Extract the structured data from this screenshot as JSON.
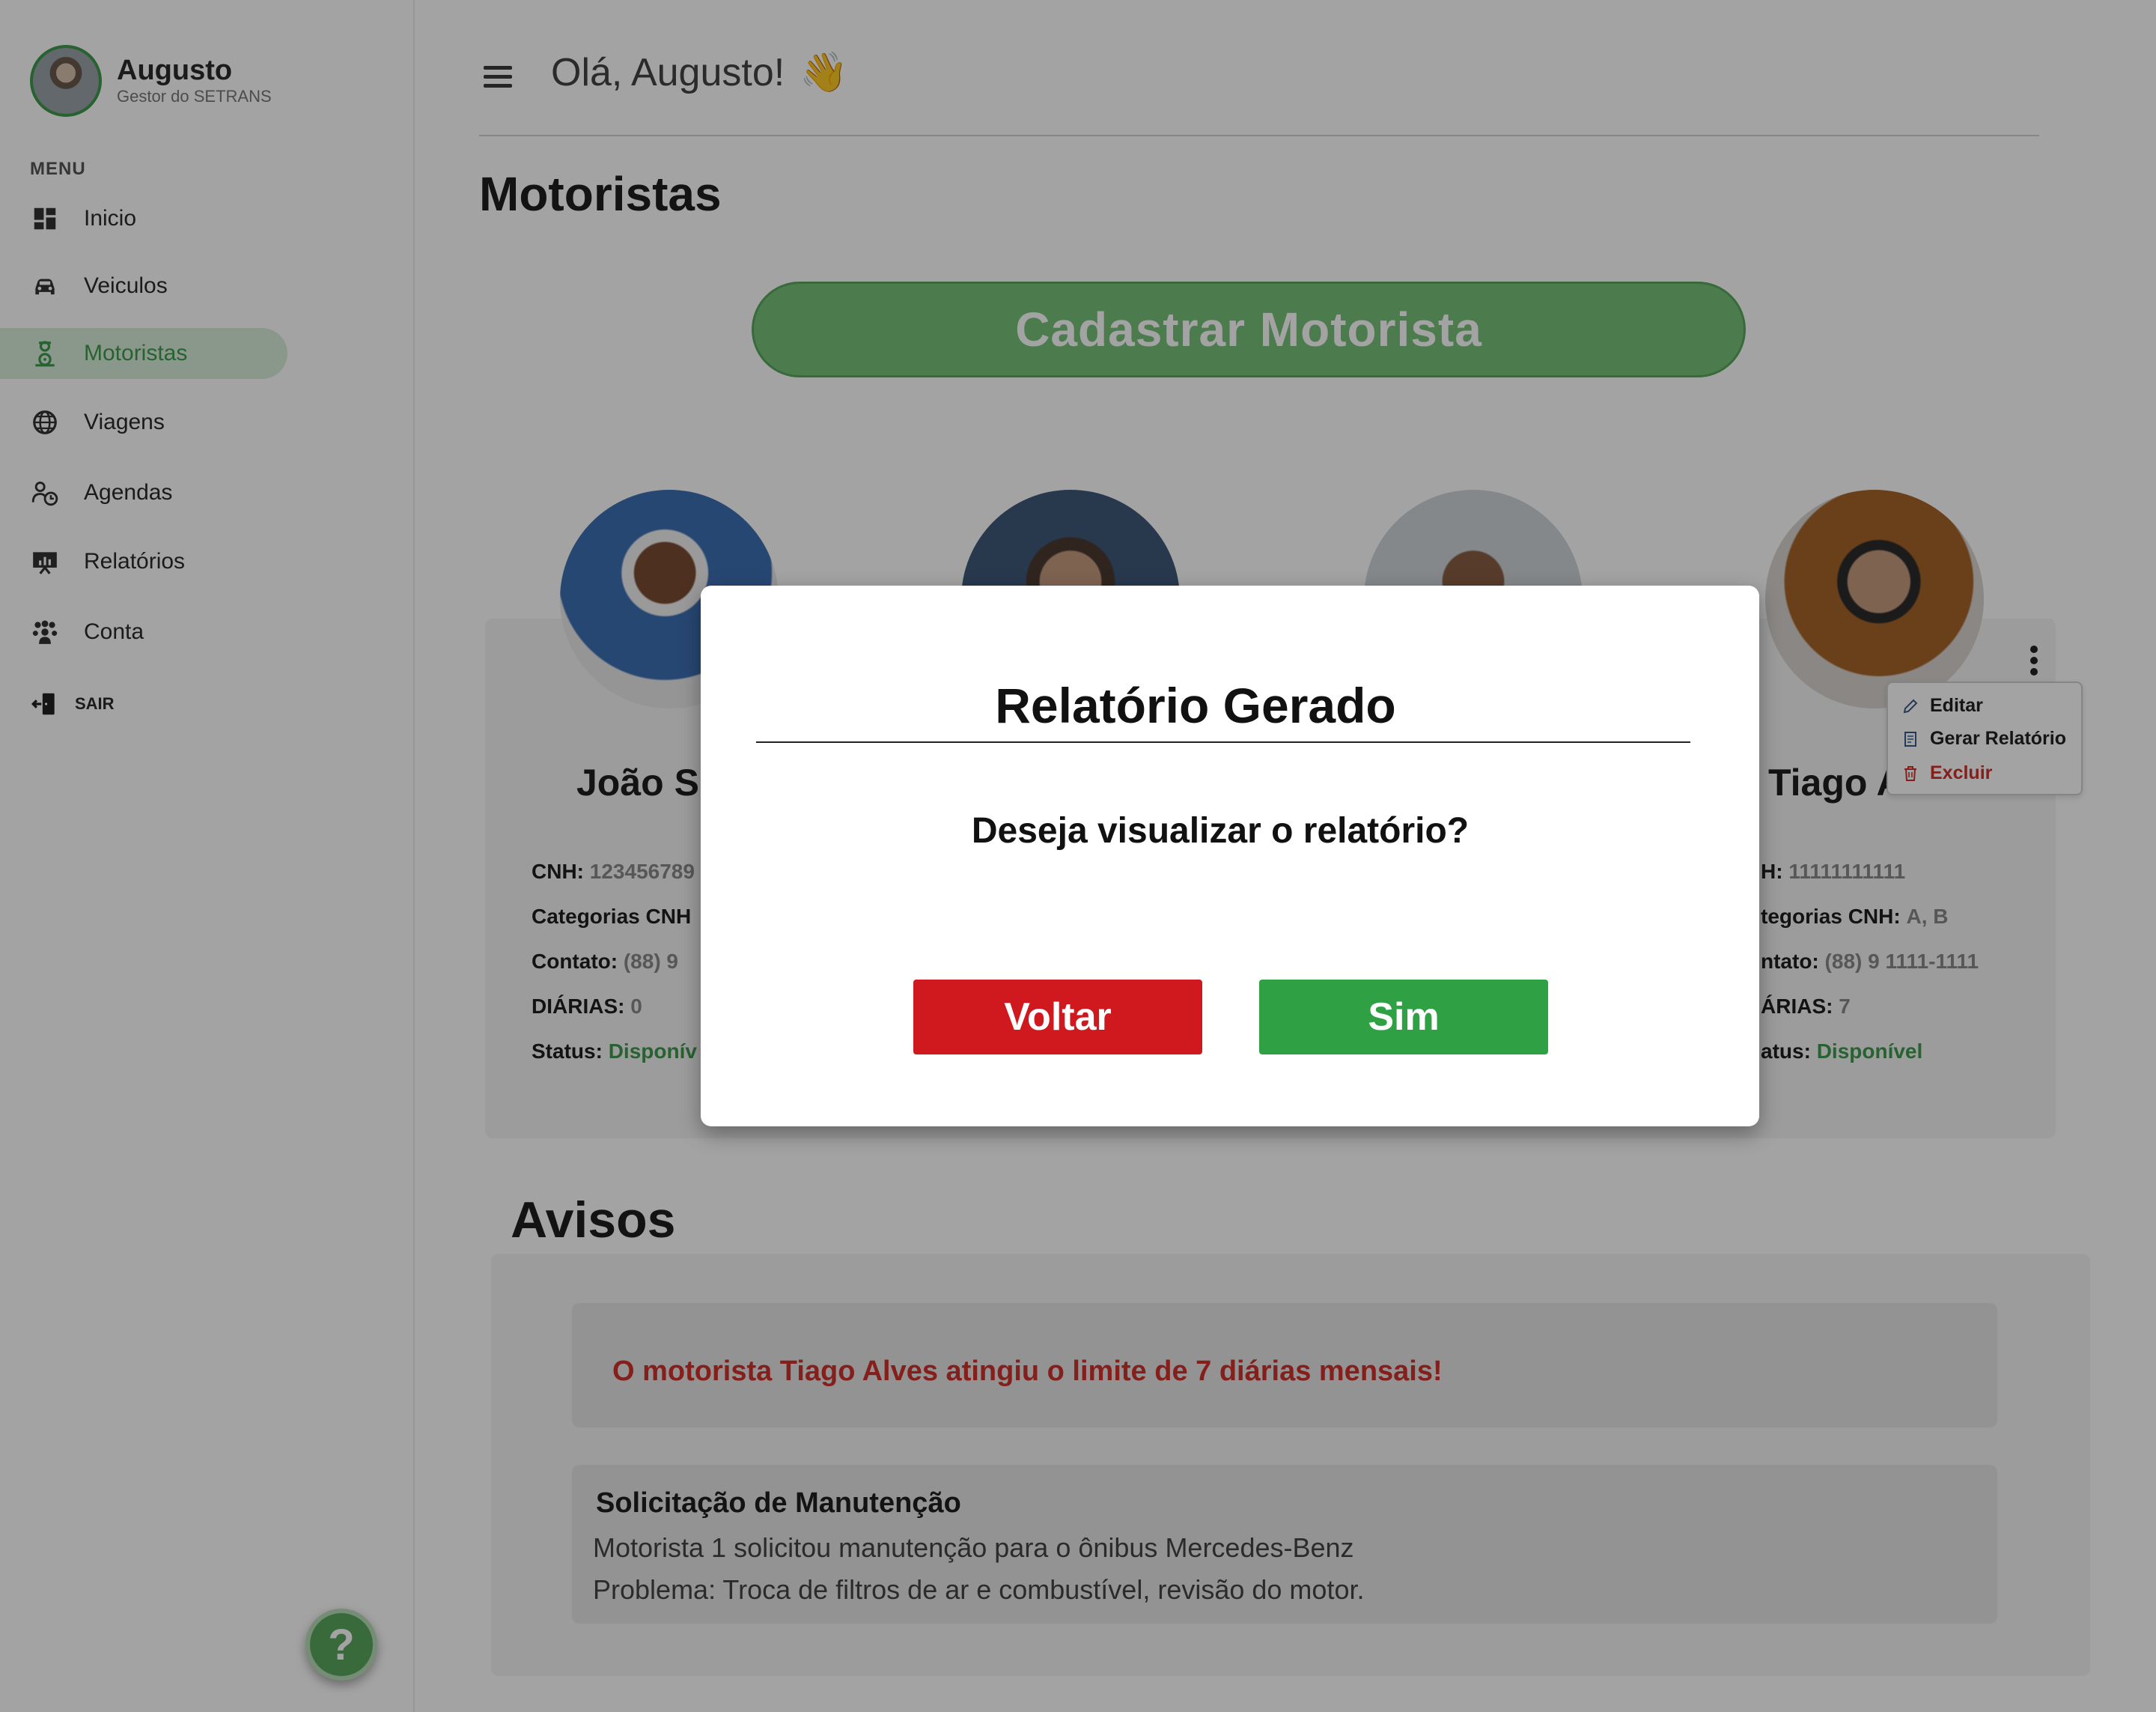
{
  "user": {
    "name": "Augusto",
    "role": "Gestor do SETRANS"
  },
  "sidebar": {
    "menu_label": "MENU",
    "items": [
      {
        "label": "Inicio",
        "icon": "dashboard-icon",
        "active": false
      },
      {
        "label": "Veiculos",
        "icon": "car-icon",
        "active": false
      },
      {
        "label": "Motoristas",
        "icon": "driver-icon",
        "active": true
      },
      {
        "label": "Viagens",
        "icon": "globe-icon",
        "active": false
      },
      {
        "label": "Agendas",
        "icon": "schedule-icon",
        "active": false
      },
      {
        "label": "Relatórios",
        "icon": "report-icon",
        "active": false
      },
      {
        "label": "Conta",
        "icon": "users-icon",
        "active": false
      }
    ],
    "logout_label": "SAIR",
    "help_label": "?"
  },
  "header": {
    "greeting": "Olá, Augusto!",
    "emoji": "👋"
  },
  "page": {
    "title": "Motoristas",
    "register_button": "Cadastrar Motorista"
  },
  "drivers": [
    {
      "name": "João Si",
      "cnh_label": "CNH:",
      "cnh": "123456789",
      "categories_label": "Categorias CNH",
      "categories": "",
      "contact_label": "Contato:",
      "contact": "(88) 9",
      "diarias_label": "DIÁRIAS:",
      "diarias": "0",
      "status_label": "Status:",
      "status": "Disponív"
    },
    {
      "name": "Tiago A",
      "cnh_label": "H:",
      "cnh": "11111111111",
      "categories_label": "tegorias CNH:",
      "categories": "A, B",
      "contact_label": "ntato:",
      "contact": "(88) 9 1111-1111",
      "diarias_label": "ÁRIAS:",
      "diarias": "7",
      "status_label": "atus:",
      "status": "Disponível"
    }
  ],
  "context_menu": {
    "edit": "Editar",
    "report": "Gerar Relatório",
    "delete": "Excluir"
  },
  "avisos": {
    "title": "Avisos",
    "alert": "O motorista Tiago Alves atingiu o limite de 7 diárias mensais!",
    "maintenance": {
      "title": "Solicitação de Manutenção",
      "line1": "Motorista 1 solicitou manutenção para o ônibus Mercedes-Benz",
      "line2": "Problema: Troca de filtros de ar e combustível, revisão do motor."
    }
  },
  "modal": {
    "title": "Relatório Gerado",
    "question": "Deseja visualizar o relatório?",
    "back_button": "Voltar",
    "confirm_button": "Sim"
  },
  "colors": {
    "accent": "#3d9a4c",
    "danger": "#d0191f",
    "confirm": "#2fa043"
  }
}
